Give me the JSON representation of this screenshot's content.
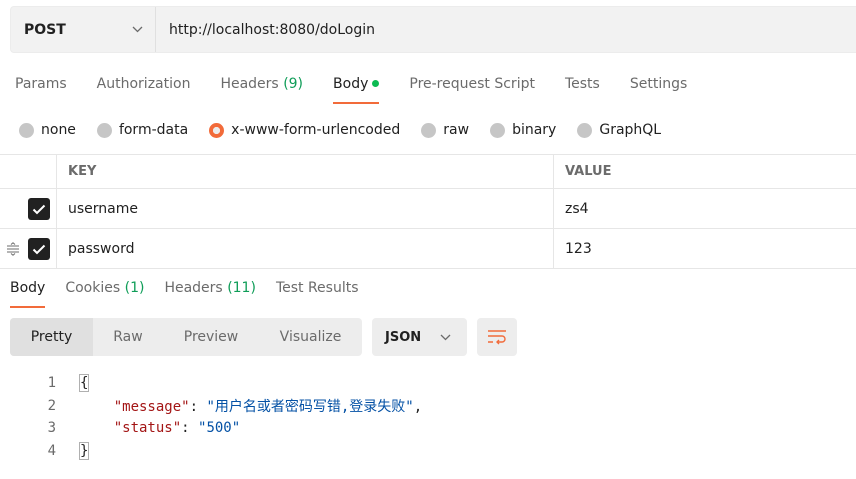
{
  "request": {
    "method": "POST",
    "url": "http://localhost:8080/doLogin"
  },
  "request_tabs": [
    {
      "label": "Params",
      "count": ""
    },
    {
      "label": "Authorization",
      "count": ""
    },
    {
      "label": "Headers ",
      "count": "(9)"
    },
    {
      "label": "Body",
      "count": ""
    },
    {
      "label": "Pre-request Script",
      "count": ""
    },
    {
      "label": "Tests",
      "count": ""
    },
    {
      "label": "Settings",
      "count": ""
    }
  ],
  "body_types": [
    "none",
    "form-data",
    "x-www-form-urlencoded",
    "raw",
    "binary",
    "GraphQL"
  ],
  "selected_body_type": "x-www-form-urlencoded",
  "table": {
    "headers": {
      "key": "KEY",
      "value": "VALUE"
    },
    "rows": [
      {
        "key": "username",
        "value": "zs4",
        "checked": true
      },
      {
        "key": "password",
        "value": "123",
        "checked": true
      }
    ]
  },
  "response_tabs": [
    {
      "label": "Body",
      "count": ""
    },
    {
      "label": "Cookies ",
      "count": "(1)"
    },
    {
      "label": "Headers ",
      "count": "(11)"
    },
    {
      "label": "Test Results",
      "count": ""
    }
  ],
  "view_modes": [
    "Pretty",
    "Raw",
    "Preview",
    "Visualize"
  ],
  "format": "JSON",
  "code_lines": [
    {
      "num": "1",
      "text": "{"
    },
    {
      "num": "2",
      "key": "\"message\"",
      "sep": ": ",
      "val": "\"用户名或者密码写错,登录失败\"",
      "end": ","
    },
    {
      "num": "3",
      "key": "\"status\"",
      "sep": ": ",
      "val": "\"500\"",
      "end": ""
    },
    {
      "num": "4",
      "text": "}"
    }
  ],
  "colors": {
    "accent": "#f26b3a",
    "count_green": "#0f9d58",
    "dot_green": "#0cbb52"
  },
  "icons": [
    "chevron-down-icon",
    "drag-handle-icon",
    "checkmark-icon",
    "wrap-lines-icon"
  ]
}
